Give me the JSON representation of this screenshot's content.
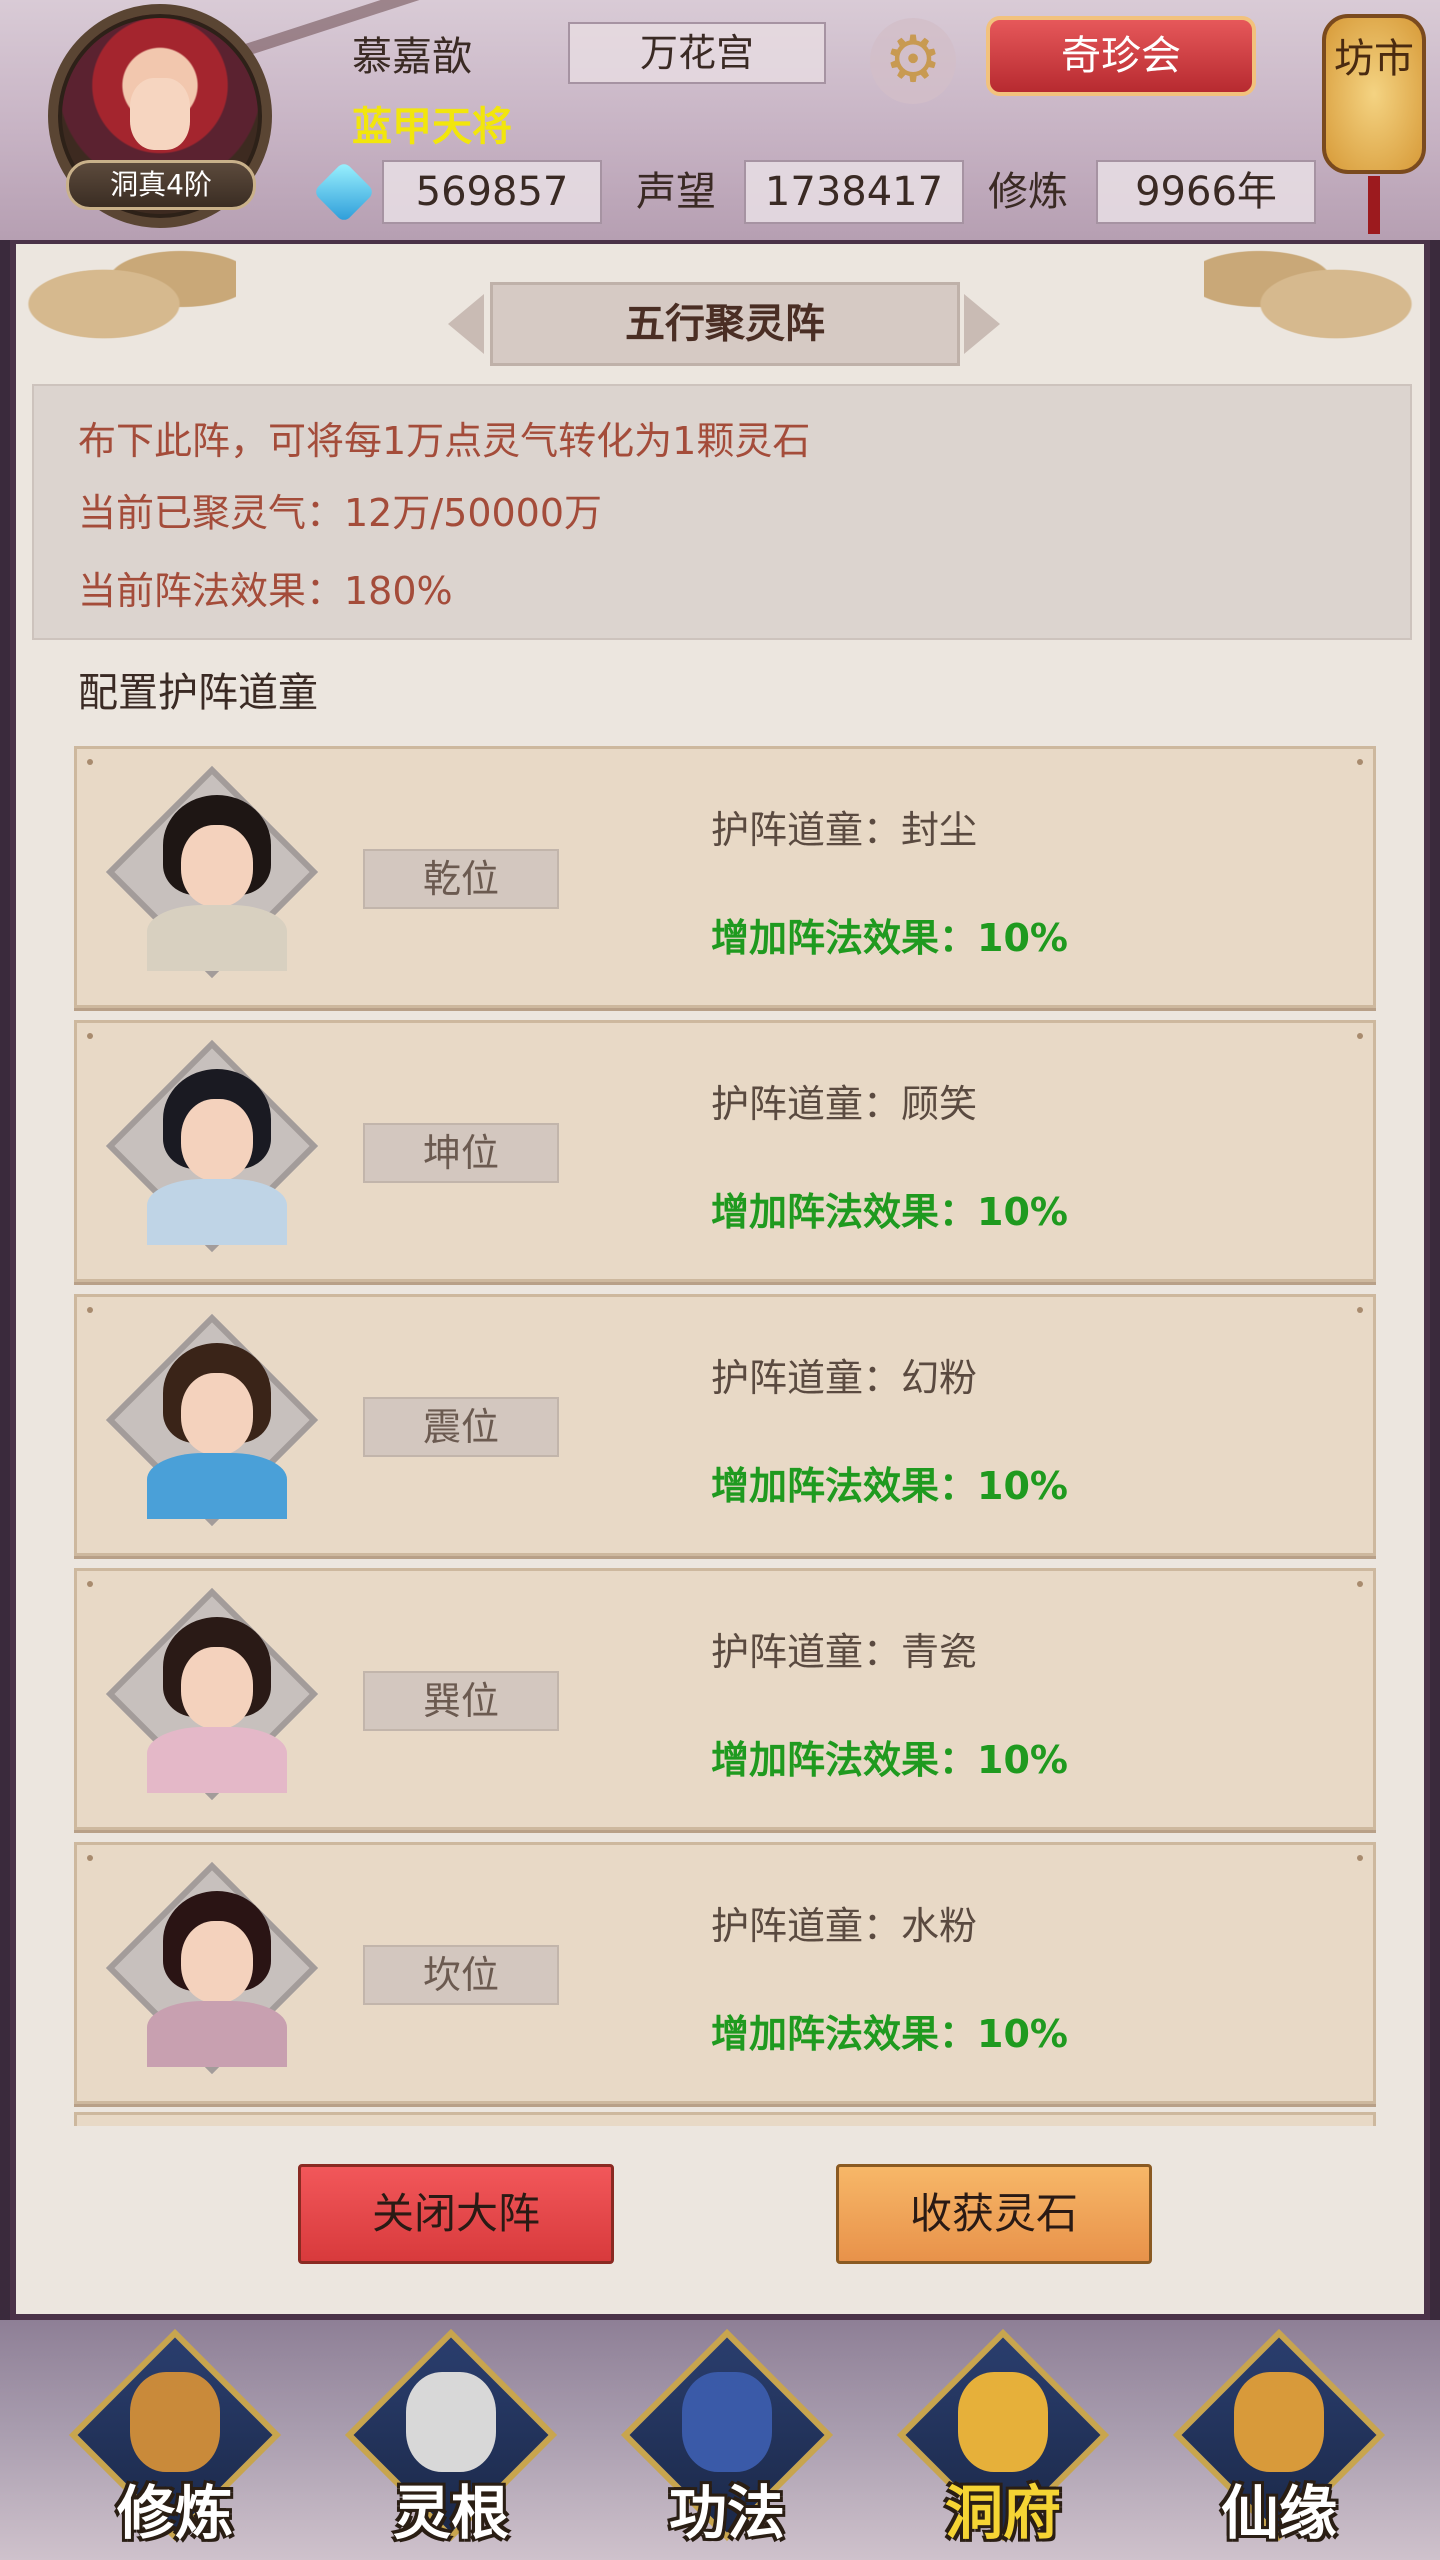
{
  "header": {
    "player_name": "慕嘉歆",
    "player_title": "蓝甲天将",
    "rank_badge": "洞真4阶",
    "sect": "万花宫",
    "qizhen_button": "奇珍会",
    "market_sign": "坊市",
    "gems": "569857",
    "reputation_label": "声望",
    "reputation": "1738417",
    "cultivation_label": "修炼",
    "cultivation": "9966年"
  },
  "panel": {
    "title": "五行聚灵阵",
    "info": [
      "布下此阵，可将每1万点灵气转化为1颗灵石",
      "当前已聚灵气：12万/50000万",
      "当前阵法效果：180%"
    ],
    "section_label": "配置护阵道童",
    "slots": [
      {
        "position": "乾位",
        "name": "护阵道童：封尘",
        "effect": "增加阵法效果：10%",
        "robe_color": "#d8d0c0",
        "hair_color": "#1e1614"
      },
      {
        "position": "坤位",
        "name": "护阵道童：顾笑",
        "effect": "增加阵法效果：10%",
        "robe_color": "#bfd4e6",
        "hair_color": "#1a1a22"
      },
      {
        "position": "震位",
        "name": "护阵道童：幻粉",
        "effect": "增加阵法效果：10%",
        "robe_color": "#4aa0d8",
        "hair_color": "#3a2418"
      },
      {
        "position": "巽位",
        "name": "护阵道童：青瓷",
        "effect": "增加阵法效果：10%",
        "robe_color": "#e4b8c8",
        "hair_color": "#2a1a16"
      },
      {
        "position": "坎位",
        "name": "护阵道童：水粉",
        "effect": "增加阵法效果：10%",
        "robe_color": "#c8a0b0",
        "hair_color": "#2a1414"
      }
    ],
    "close_button": "关闭大阵",
    "harvest_button": "收获灵石"
  },
  "nav": {
    "items": [
      {
        "label": "修炼",
        "icon": "hooded-monk-icon",
        "active": false
      },
      {
        "label": "灵根",
        "icon": "yin-yang-sword-icon",
        "active": false
      },
      {
        "label": "功法",
        "icon": "scripture-book-icon",
        "active": false
      },
      {
        "label": "洞府",
        "icon": "pagoda-icon",
        "active": true
      },
      {
        "label": "仙缘",
        "icon": "gourd-icon",
        "active": false
      }
    ]
  },
  "colors": {
    "info_text": "#a44c3a",
    "effect_text": "#1f9a1f",
    "title_yellow": "#f2e60c",
    "active_nav": "#f5d434"
  }
}
